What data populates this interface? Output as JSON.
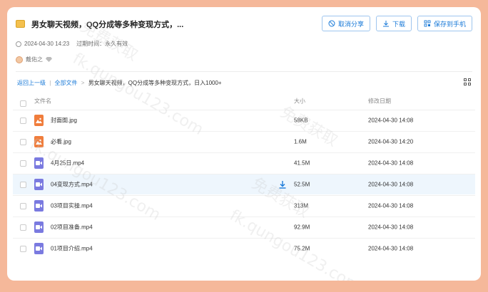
{
  "header": {
    "title": "男女聊天视频，QQ分成等多种变现方式，...",
    "cancel_share": "取消分享",
    "download": "下载",
    "save_to_phone": "保存到手机"
  },
  "meta": {
    "date": "2024-04-30 14:23",
    "expire_label": "过期时间：永久有效"
  },
  "user": {
    "name": "戴佑之"
  },
  "breadcrumb": {
    "back": "返回上一级",
    "all_files": "全部文件",
    "current": "男女聊天视频，QQ分成等多种变现方式，日入1000+"
  },
  "table": {
    "columns": {
      "name": "文件名",
      "size": "大小",
      "date": "修改日期"
    },
    "rows": [
      {
        "name": "封面图.jpg",
        "size": "58KB",
        "date": "2024-04-30 14:08",
        "type": "image"
      },
      {
        "name": "必看.jpg",
        "size": "1.6M",
        "date": "2024-04-30 14:20",
        "type": "image"
      },
      {
        "name": "4月25日.mp4",
        "size": "41.5M",
        "date": "2024-04-30 14:08",
        "type": "video"
      },
      {
        "name": "04变现方式.mp4",
        "size": "52.5M",
        "date": "2024-04-30 14:08",
        "type": "video"
      },
      {
        "name": "03项目实操.mp4",
        "size": "313M",
        "date": "2024-04-30 14:08",
        "type": "video"
      },
      {
        "name": "02项目准备.mp4",
        "size": "92.9M",
        "date": "2024-04-30 14:08",
        "type": "video"
      },
      {
        "name": "01项目介绍.mp4",
        "size": "75.2M",
        "date": "2024-04-30 14:08",
        "type": "video"
      }
    ]
  },
  "watermarks": [
    "免费获取",
    "fk.qungou123.com",
    "免费获取",
    "fk.qungou123.com",
    "免费获取",
    "fk.qungou123.com"
  ],
  "colors": {
    "accent": "#1a7ad8",
    "background": "#f5b89a",
    "image_icon": "#f07d3c",
    "video_icon": "#7a7ae0"
  }
}
